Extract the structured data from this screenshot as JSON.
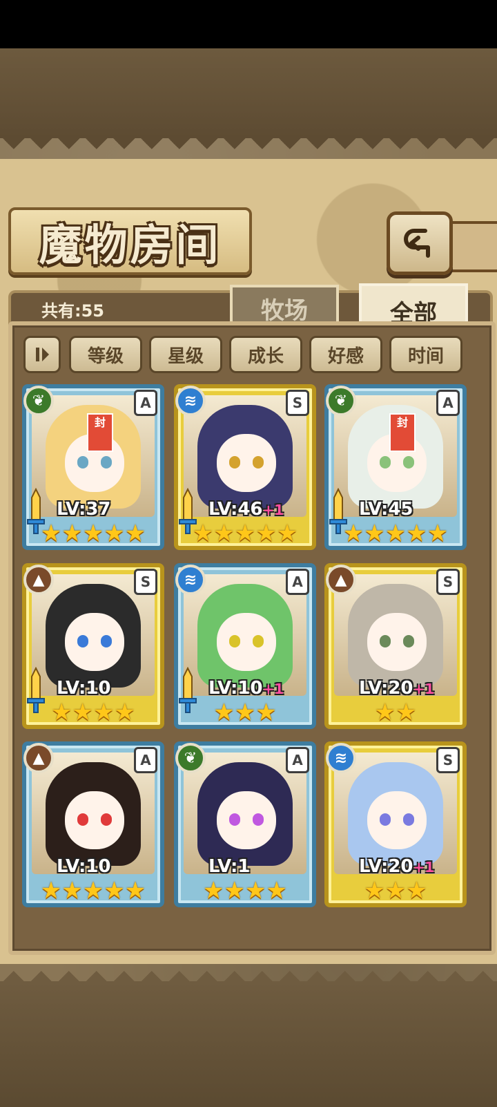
{
  "header": {
    "title": "魔物房间"
  },
  "tabs": {
    "count_label": "共有:55",
    "pasture": "牧场",
    "all": "全部"
  },
  "sort": {
    "level": "等级",
    "star": "星级",
    "growth": "成长",
    "affection": "好感",
    "time": "时间"
  },
  "monsters": [
    {
      "rank": "A",
      "element": "grass",
      "level": "LV:37",
      "plus": "",
      "stars": "★★★★★",
      "tag": "封"
    },
    {
      "rank": "S",
      "element": "water",
      "level": "LV:46",
      "plus": "+1",
      "stars": "★★★★★"
    },
    {
      "rank": "A",
      "element": "grass",
      "level": "LV:45",
      "plus": "",
      "stars": "★★★★★",
      "tag": "封"
    },
    {
      "rank": "S",
      "element": "earth",
      "level": "LV:10",
      "plus": "",
      "stars": "★★★★"
    },
    {
      "rank": "A",
      "element": "water",
      "level": "LV:10",
      "plus": "+1",
      "stars": "★★★"
    },
    {
      "rank": "S",
      "element": "earth",
      "level": "LV:20",
      "plus": "+1",
      "stars": "★★"
    },
    {
      "rank": "A",
      "element": "earth",
      "level": "LV:10",
      "plus": "",
      "stars": "★★★★★"
    },
    {
      "rank": "A",
      "element": "grass",
      "level": "LV:1",
      "plus": "",
      "stars": "★★★★"
    },
    {
      "rank": "S",
      "element": "water",
      "level": "LV:20",
      "plus": "+1",
      "stars": "★★★"
    }
  ],
  "colors": {
    "gold_frame": "#e8cd3d",
    "blue_frame": "#8fc4d9",
    "panel": "#7a6242"
  }
}
